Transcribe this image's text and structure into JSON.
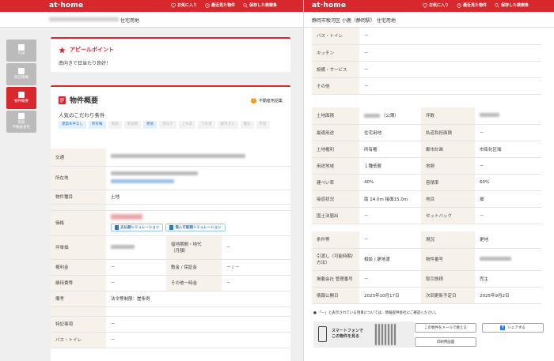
{
  "brand": {
    "logo": "at·home",
    "accent": "#d8272d"
  },
  "header_links": {
    "favorites": "お気に入り",
    "recent": "最近見た物件",
    "saved": "保存した検索条"
  },
  "left": {
    "breadcrumb": "住宅用地",
    "nav": [
      {
        "label": "TOP"
      },
      {
        "label": "周辺情報"
      },
      {
        "label": "物件概要"
      },
      {
        "label": "取扱\n不動産会社"
      }
    ],
    "appeal": {
      "title": "アピールポイント",
      "body": "南向きで日当たり良好！"
    },
    "overview": {
      "title": "物件概要",
      "help": "不動産用語集",
      "kodawari_title": "人気のこだわり条件",
      "tags": [
        {
          "label": "建築条件なし",
          "on": true
        },
        {
          "label": "所有権",
          "on": true
        },
        {
          "label": "角地",
          "on": false
        },
        {
          "label": "南道路",
          "on": false
        },
        {
          "label": "更地",
          "on": true
        },
        {
          "label": "南向き",
          "on": false
        },
        {
          "label": "上水道",
          "on": false
        },
        {
          "label": "下水道",
          "on": false
        },
        {
          "label": "都市ガス",
          "on": false
        },
        {
          "label": "電気",
          "on": false
        },
        {
          "label": "平坦",
          "on": false
        }
      ],
      "rows": {
        "traffic": "交通",
        "address": "所在地",
        "type_k": "物件種目",
        "type_v": "土地",
        "price": "価格",
        "sim1": "支払額シミュレーション",
        "sim2": "借入可能額シミュレーション",
        "tsubo": "坪単価",
        "lease_k": "借地期間・地代\n（月額）",
        "lease_v": "－",
        "key_k": "権利金",
        "key_v": "－",
        "deposit_k": "敷金 / 保証金",
        "deposit_v": "－ / －",
        "maint_k": "維持費等",
        "maint_v": "－",
        "other_k": "その他一時金",
        "other_v": "－",
        "remark_k": "備考",
        "remark_v": "法令等制限：崖条例",
        "special_k": "特記事項",
        "special_v": "－",
        "bath_k": "バス・トイレ",
        "bath_v": "－"
      }
    }
  },
  "right": {
    "breadcrumb": "静岡市駿河区 小鹿（静岡駅） 住宅用地",
    "top_rows": [
      {
        "k": "バス・トイレ",
        "v": "－"
      },
      {
        "k": "キッチン",
        "v": "－"
      },
      {
        "k": "設備・サービス",
        "v": "－"
      },
      {
        "k": "その他",
        "v": "－"
      }
    ],
    "land": {
      "area_k": "土地面積",
      "area_v": "（公簿）",
      "tsubo_k": "坪数",
      "use_k": "最適用途",
      "use_v": "住宅用地",
      "road_k": "私道負担面積",
      "road_v": "－",
      "right_k": "土地権利",
      "right_v": "所有権",
      "plan_k": "都市計画",
      "plan_v": "市街化区域",
      "zone_k": "用途地域",
      "zone_v": "１種低層",
      "level_k": "地勢",
      "level_v": "－",
      "bcr_k": "建ぺい率",
      "bcr_v": "40%",
      "far_k": "容積率",
      "far_v": "60%",
      "contact_k": "接道状況",
      "contact_v": "南 14.0m 接面15.0m",
      "cat_k": "地目",
      "cat_v": "畑",
      "notice_k": "国土法届出",
      "notice_v": "－",
      "setback_k": "セットバック",
      "setback_v": "－"
    },
    "terms": {
      "cond_k": "条件等",
      "cond_v": "－",
      "status_k": "現況",
      "status_v": "更地",
      "handover_k": "引渡し（可能時期/\n方法）",
      "handover_v": "相談 / 更地渡",
      "num_k": "物件番号",
      "mgmt_k": "掲載会社 管理番号",
      "mgmt_v": "－",
      "deal_k": "取引態様",
      "deal_v": "売主",
      "pub_k": "情報公開日",
      "pub_v": "2023年10月17日",
      "next_k": "次回更新予定日",
      "next_v": "2025年9月2日"
    },
    "note": "「－」と表示されている項目については、情報提供会社にご確認ください。",
    "qr_text": "スマートフォンで\nこの物件を見る",
    "mail_btn": "この物件をメールで教える",
    "share_btn": "シェアする",
    "print_btn": "印刷用画面"
  }
}
